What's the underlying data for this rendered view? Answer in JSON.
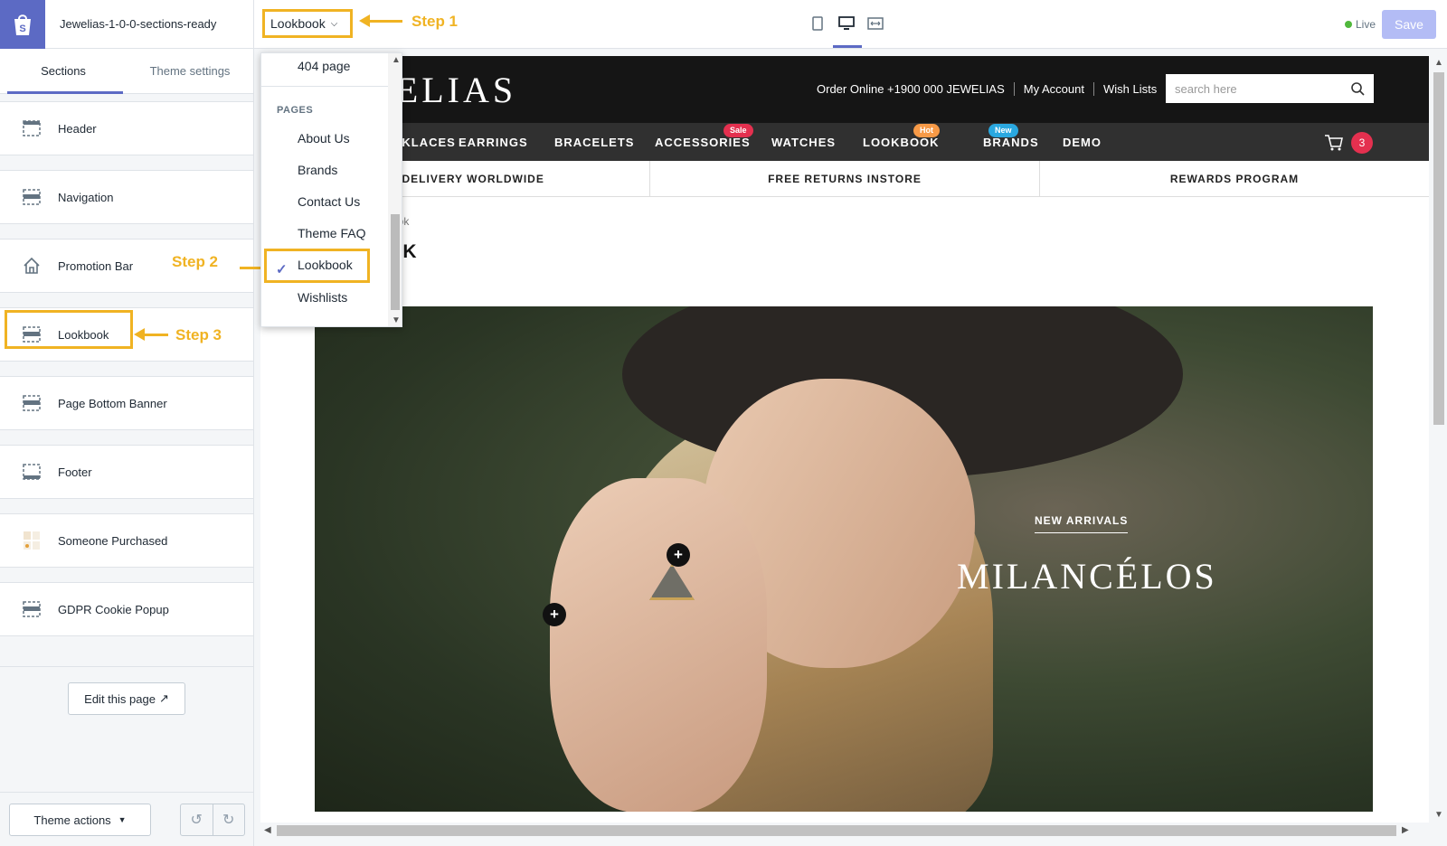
{
  "topbar": {
    "theme_name": "Jewelias-1-0-0-sections-ready",
    "page_selector": "Lookbook",
    "live_label": "Live",
    "save_label": "Save"
  },
  "steps": {
    "step1": "Step 1",
    "step2": "Step 2",
    "step3": "Step 3"
  },
  "sidebar": {
    "tabs": [
      "Sections",
      "Theme settings"
    ],
    "sections": [
      "Header",
      "Navigation",
      "Promotion Bar",
      "Lookbook",
      "Page Bottom Banner",
      "Footer",
      "Someone Purchased",
      "GDPR Cookie Popup"
    ],
    "edit_page": "Edit this page",
    "theme_actions": "Theme actions"
  },
  "dropdown": {
    "top_item": "404 page",
    "group": "PAGES",
    "items": [
      "About Us",
      "Brands",
      "Contact Us",
      "Theme FAQ",
      "Lookbook",
      "Wishlists"
    ],
    "selected": "Lookbook"
  },
  "store": {
    "logo": "JEWELIAS",
    "links": [
      "Order Online +1900 000 JEWELIAS",
      "My Account",
      "Wish Lists"
    ],
    "search_placeholder": "search here",
    "nav": [
      "NECKLACES",
      "EARRINGS",
      "BRACELETS",
      "ACCESSORIES",
      "WATCHES",
      "LOOKBOOK",
      "BRANDS",
      "DEMO"
    ],
    "nav_visible_first": "CKLACES",
    "badges": {
      "accessories": "Sale",
      "lookbook": "Hot",
      "brands": "New"
    },
    "badge_colors": {
      "sale": "#e4304f",
      "hot": "#f79a47",
      "new": "#2aa8e0"
    },
    "cart_count": "3",
    "promo": [
      "FREE DELIVERY WORLDWIDE",
      "FREE RETURNS INSTORE",
      "REWARDS PROGRAM"
    ],
    "breadcrumb": "ook",
    "page_title": "OK",
    "hero_sub": "NEW ARRIVALS",
    "hero_title": "MILANCÉLOS",
    "hotspot": "+"
  }
}
